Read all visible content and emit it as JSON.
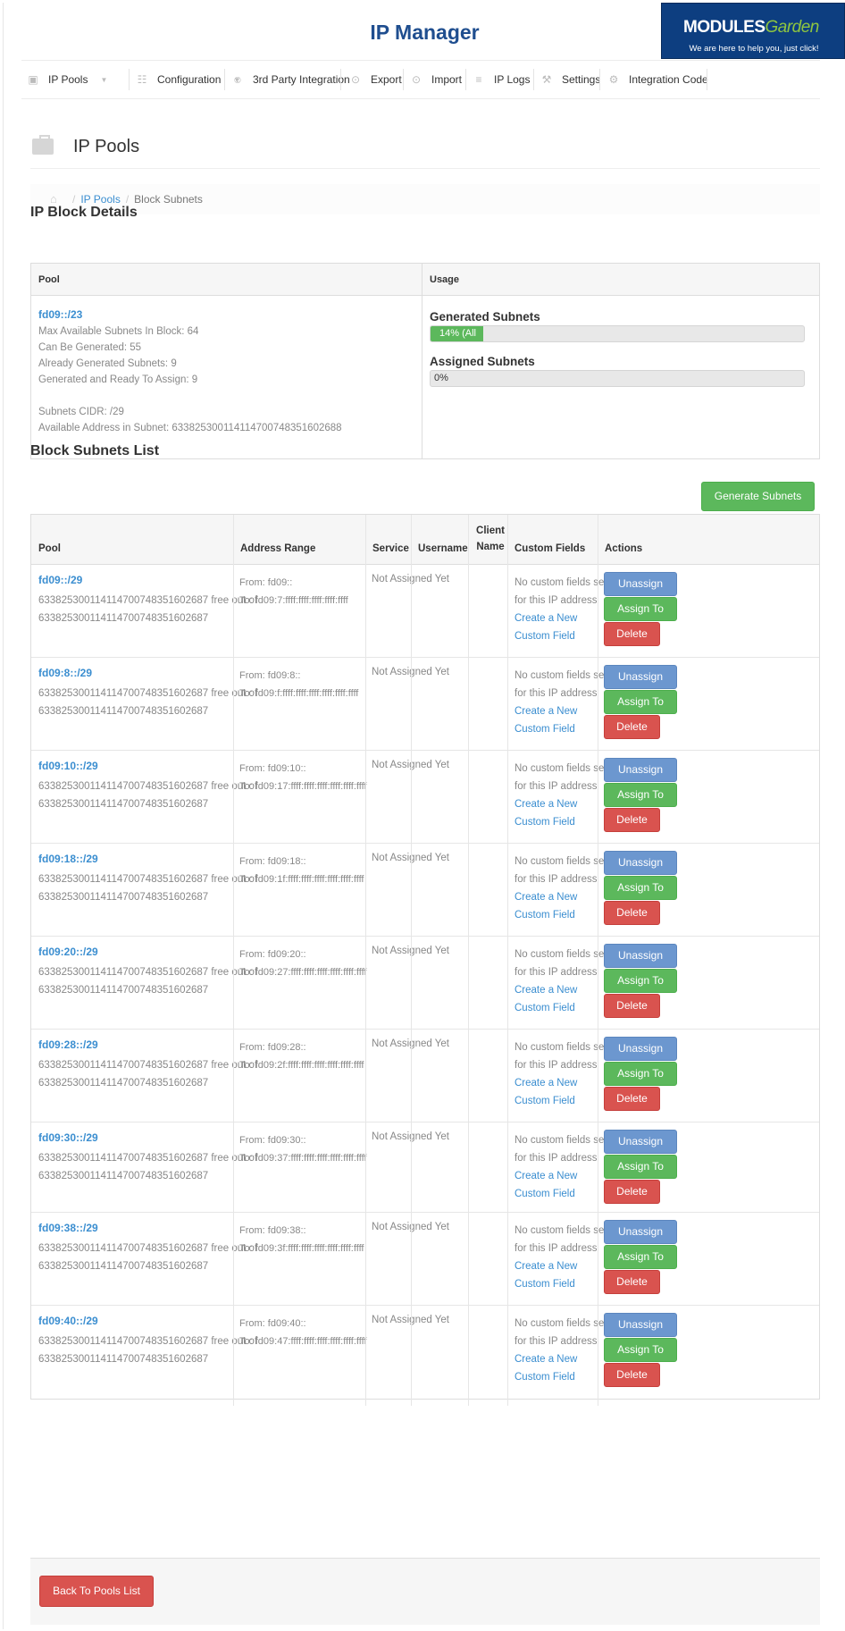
{
  "header": {
    "title": "IP Manager",
    "brand_left": "MODULES",
    "brand_right": "Garden",
    "brand_tagline": "We are here to help you, just click!"
  },
  "nav": [
    {
      "label": "IP Pools",
      "icon": "briefcase-icon",
      "caret": true
    },
    {
      "label": "Configuration",
      "icon": "grid-icon",
      "caret": true
    },
    {
      "label": "3rd Party Integration",
      "icon": "users-icon",
      "caret": false
    },
    {
      "label": "Export",
      "icon": "export-icon",
      "caret": false
    },
    {
      "label": "Import",
      "icon": "import-icon",
      "caret": false
    },
    {
      "label": "IP Logs",
      "icon": "list-icon",
      "caret": false
    },
    {
      "label": "Settings",
      "icon": "wrench-icon",
      "caret": false
    },
    {
      "label": "Integration Code",
      "icon": "gears-icon",
      "caret": false
    }
  ],
  "page": {
    "title": "IP Pools"
  },
  "breadcrumb": {
    "link": "IP Pools",
    "current": "Block Subnets"
  },
  "details": {
    "heading": "IP Block Details",
    "col_pool": "Pool",
    "col_usage": "Usage",
    "pool_link": "fd09::/23",
    "lines": [
      "Max Available Subnets In Block: 64",
      "Can Be Generated: 55",
      "Already Generated Subnets: 9",
      "Generated and Ready To Assign: 9",
      "",
      "Subnets CIDR: /29",
      "Available Address in Subnet: 633825300114114700748351602688"
    ],
    "generated_title": "Generated Subnets",
    "generated_label": "14% (All",
    "generated_fraction": 0.14,
    "assigned_title": "Assigned Subnets",
    "assigned_label": "0%",
    "assigned_fraction": 0
  },
  "list": {
    "heading": "Block Subnets List",
    "generate_label": "Generate Subnets",
    "columns": {
      "pool": "Pool",
      "range": "Address Range",
      "service": "Service",
      "username": "Username",
      "client_name": "Client Name",
      "custom_fields": "Custom Fields",
      "actions": "Actions"
    },
    "buttons": {
      "unassign": "Unassign",
      "assign": "Assign To",
      "delete": "Delete"
    },
    "service_text": "Not Assigned Yet",
    "cf_text": "No custom fields set for this IP address",
    "cf_link": "Create a New Custom Field",
    "rows": [
      {
        "pool": "fd09::/29",
        "free": "633825300114114700748351602687 free out of 633825300114114700748351602687",
        "from": "From: fd09::",
        "to": "To: fd09:7:ffff:ffff:ffff:ffff:ffff"
      },
      {
        "pool": "fd09:8::/29",
        "free": "633825300114114700748351602687 free out of 633825300114114700748351602687",
        "from": "From: fd09:8::",
        "to": "To: fd09:f:ffff:ffff:ffff:ffff:ffff:ffff"
      },
      {
        "pool": "fd09:10::/29",
        "free": "633825300114114700748351602687 free out of 633825300114114700748351602687",
        "from": "From: fd09:10::",
        "to": "To: fd09:17:ffff:ffff:ffff:ffff:ffff:ffff"
      },
      {
        "pool": "fd09:18::/29",
        "free": "633825300114114700748351602687 free out of 633825300114114700748351602687",
        "from": "From: fd09:18::",
        "to": "To: fd09:1f:ffff:ffff:ffff:ffff:ffff:ffff"
      },
      {
        "pool": "fd09:20::/29",
        "free": "633825300114114700748351602687 free out of 633825300114114700748351602687",
        "from": "From: fd09:20::",
        "to": "To: fd09:27:ffff:ffff:ffff:ffff:ffff:ffff"
      },
      {
        "pool": "fd09:28::/29",
        "free": "633825300114114700748351602687 free out of 633825300114114700748351602687",
        "from": "From: fd09:28::",
        "to": "To: fd09:2f:ffff:ffff:ffff:ffff:ffff:ffff"
      },
      {
        "pool": "fd09:30::/29",
        "free": "633825300114114700748351602687 free out of 633825300114114700748351602687",
        "from": "From: fd09:30::",
        "to": "To: fd09:37:ffff:ffff:ffff:ffff:ffff:ffff"
      },
      {
        "pool": "fd09:38::/29",
        "free": "633825300114114700748351602687 free out of 633825300114114700748351602687",
        "from": "From: fd09:38::",
        "to": "To: fd09:3f:ffff:ffff:ffff:ffff:ffff:ffff"
      },
      {
        "pool": "fd09:40::/29",
        "free": "633825300114114700748351602687 free out of 633825300114114700748351602687",
        "from": "From: fd09:40::",
        "to": "To: fd09:47:ffff:ffff:ffff:ffff:ffff:ffff"
      }
    ]
  },
  "footer": {
    "back_label": "Back To Pools List"
  },
  "colors": {
    "title_blue": "#1f4e8f",
    "link_blue": "#3b8ed0",
    "success_green": "#5cb85c",
    "danger_red": "#d9534f",
    "primary_blue": "#6c97cf"
  }
}
